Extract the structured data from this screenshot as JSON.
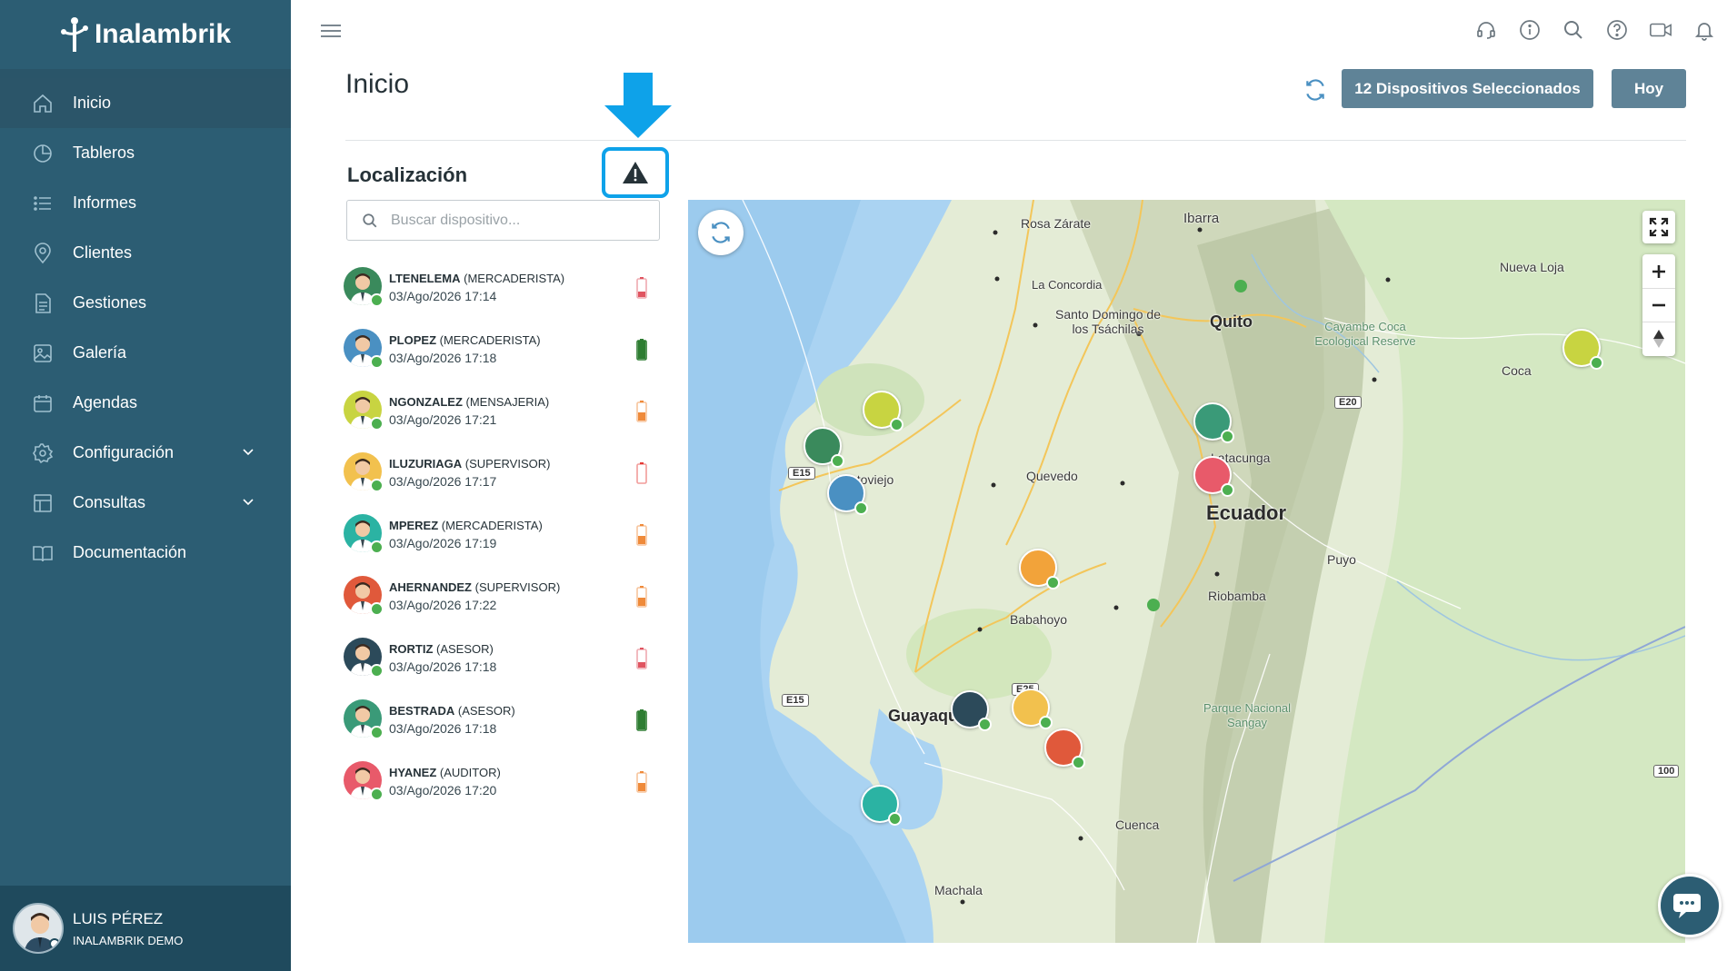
{
  "app": {
    "brand": "Inalambrik"
  },
  "sidebar": {
    "items": [
      {
        "label": "Inicio",
        "icon": "home-icon",
        "active": true
      },
      {
        "label": "Tableros",
        "icon": "pie-chart-icon"
      },
      {
        "label": "Informes",
        "icon": "list-icon"
      },
      {
        "label": "Clientes",
        "icon": "location-pin-icon"
      },
      {
        "label": "Gestiones",
        "icon": "document-icon"
      },
      {
        "label": "Galería",
        "icon": "image-icon"
      },
      {
        "label": "Agendas",
        "icon": "calendar-icon"
      },
      {
        "label": "Configuración",
        "icon": "gear-icon",
        "expandable": true
      },
      {
        "label": "Consultas",
        "icon": "table-icon",
        "expandable": true
      },
      {
        "label": "Documentación",
        "icon": "book-icon"
      }
    ],
    "user": {
      "name": "LUIS PÉREZ",
      "org": "INALAMBRIK DEMO"
    }
  },
  "header": {
    "title": "Inicio",
    "devices_button": "12 Dispositivos Seleccionados",
    "today_button": "Hoy",
    "icons": [
      "headset-icon",
      "info-icon",
      "search-icon",
      "help-icon",
      "video-icon",
      "bell-icon"
    ]
  },
  "location": {
    "title": "Localización",
    "search_placeholder": "Buscar dispositivo...",
    "devices": [
      {
        "name": "LTENELEMA",
        "role": "(MERCADERISTA)",
        "time": "03/Ago/2026 17:14",
        "battery": "low",
        "color": "#3a8a5c"
      },
      {
        "name": "PLOPEZ",
        "role": "(MERCADERISTA)",
        "time": "03/Ago/2026 17:18",
        "battery": "full",
        "color": "#4a90c2"
      },
      {
        "name": "NGONZALEZ",
        "role": "(MENSAJERIA)",
        "time": "03/Ago/2026 17:21",
        "battery": "medium",
        "color": "#c8d441"
      },
      {
        "name": "ILUZURIAGA",
        "role": "(SUPERVISOR)",
        "time": "03/Ago/2026 17:17",
        "battery": "empty",
        "color": "#f2c14e"
      },
      {
        "name": "MPEREZ",
        "role": "(MERCADERISTA)",
        "time": "03/Ago/2026 17:19",
        "battery": "medium",
        "color": "#2bb3a3"
      },
      {
        "name": "AHERNANDEZ",
        "role": "(SUPERVISOR)",
        "time": "03/Ago/2026 17:22",
        "battery": "medium",
        "color": "#e0593b"
      },
      {
        "name": "RORTIZ",
        "role": "(ASESOR)",
        "time": "03/Ago/2026 17:18",
        "battery": "low",
        "color": "#2c4a5a"
      },
      {
        "name": "BESTRADA",
        "role": "(ASESOR)",
        "time": "03/Ago/2026 17:18",
        "battery": "full",
        "color": "#3a9a78"
      },
      {
        "name": "HYANEZ",
        "role": "(AUDITOR)",
        "time": "03/Ago/2026 17:20",
        "battery": "medium",
        "color": "#e85a6a"
      }
    ]
  },
  "map": {
    "places": [
      {
        "label": "Rosa Zárate"
      },
      {
        "label": "Ibarra"
      },
      {
        "label": "La Concordia"
      },
      {
        "label": "Santo Domingo de los Tsáchilas"
      },
      {
        "label": "Quito"
      },
      {
        "label": "Cayambe Coca Ecological Reserve"
      },
      {
        "label": "Nueva Loja"
      },
      {
        "label": "Coca"
      },
      {
        "label": "Portoviejo"
      },
      {
        "label": "Quevedo"
      },
      {
        "label": "Latacunga"
      },
      {
        "label": "Ecuador"
      },
      {
        "label": "Puyo"
      },
      {
        "label": "Riobamba"
      },
      {
        "label": "Babahoyo"
      },
      {
        "label": "Guayaquil"
      },
      {
        "label": "Parque Nacional Sangay"
      },
      {
        "label": "Cuenca"
      },
      {
        "label": "Machala"
      }
    ],
    "roads": [
      "E15",
      "E15",
      "E20",
      "E25",
      "100"
    ]
  },
  "colors": {
    "sidebar": "#2c5d73",
    "button": "#5f8397",
    "annotation": "#0ea2e9",
    "online": "#4caf50"
  }
}
